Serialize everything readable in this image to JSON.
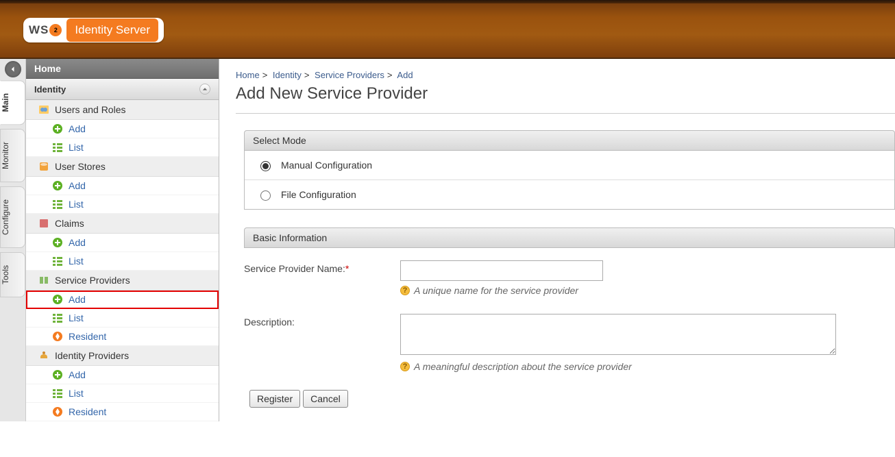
{
  "app_title": "Identity Server",
  "logo_brand": "WSO2",
  "rail": {
    "tabs": [
      "Main",
      "Monitor",
      "Configure",
      "Tools"
    ],
    "active_index": 0
  },
  "sidebar": {
    "home": "Home",
    "section": "Identity",
    "groups": [
      {
        "label": "Users and Roles",
        "items": [
          {
            "label": "Add",
            "icon": "add"
          },
          {
            "label": "List",
            "icon": "list"
          }
        ]
      },
      {
        "label": "User Stores",
        "items": [
          {
            "label": "Add",
            "icon": "add"
          },
          {
            "label": "List",
            "icon": "list"
          }
        ]
      },
      {
        "label": "Claims",
        "items": [
          {
            "label": "Add",
            "icon": "add"
          },
          {
            "label": "List",
            "icon": "list"
          }
        ]
      },
      {
        "label": "Service Providers",
        "items": [
          {
            "label": "Add",
            "icon": "add",
            "highlight": true
          },
          {
            "label": "List",
            "icon": "list"
          },
          {
            "label": "Resident",
            "icon": "resident"
          }
        ]
      },
      {
        "label": "Identity Providers",
        "items": [
          {
            "label": "Add",
            "icon": "add"
          },
          {
            "label": "List",
            "icon": "list"
          },
          {
            "label": "Resident",
            "icon": "resident"
          }
        ]
      }
    ]
  },
  "breadcrumb": [
    "Home",
    "Identity",
    "Service Providers",
    "Add"
  ],
  "page_title": "Add New Service Provider",
  "select_mode": {
    "header": "Select Mode",
    "options": [
      "Manual Configuration",
      "File Configuration"
    ],
    "selected_index": 0
  },
  "basic_info": {
    "header": "Basic Information",
    "fields": {
      "name_label": "Service Provider Name:",
      "name_required": "*",
      "name_value": "",
      "name_hint": "A unique name for the service provider",
      "desc_label": "Description:",
      "desc_value": "",
      "desc_hint": "A meaningful description about the service provider"
    }
  },
  "buttons": {
    "register": "Register",
    "cancel": "Cancel"
  }
}
